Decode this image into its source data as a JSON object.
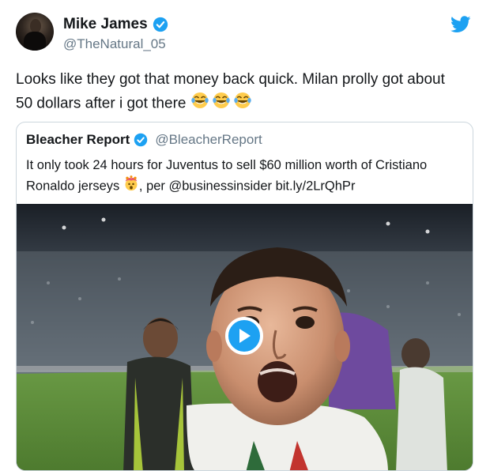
{
  "tweet": {
    "author_name": "Mike James",
    "author_handle": "@TheNatural_05",
    "text_line1": "Looks like they got that money back quick. Milan prolly got about",
    "text_line2": "50 dollars after i got there"
  },
  "quoted_tweet": {
    "author_name": "Bleacher Report",
    "author_handle": "@BleacherReport",
    "text_line1": "It only took 24 hours for Juventus to sell $60 million worth of Cristiano",
    "text_line2_a": "Ronaldo jerseys",
    "text_line2_b": ", per @businessinsider bit.ly/2LrQhPr"
  },
  "icons": {
    "verified": "verified-badge-icon",
    "twitter": "twitter-bird-icon",
    "laughing": "tears-of-joy-emoji",
    "exploding": "exploding-head-emoji",
    "play": "play-icon"
  },
  "colors": {
    "brand_blue": "#1da1f2",
    "handle_gray": "#657786",
    "border": "#ccd6dd"
  }
}
